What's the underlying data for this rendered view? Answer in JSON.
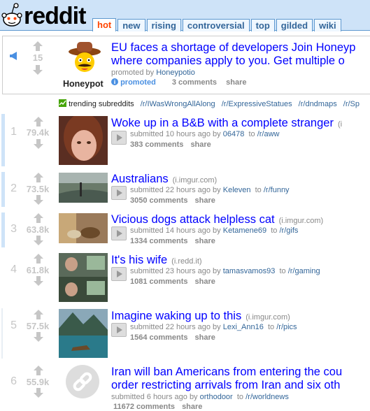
{
  "header": {
    "brand": "reddit",
    "tabs": [
      "hot",
      "new",
      "rising",
      "controversial",
      "top",
      "gilded",
      "wiki"
    ],
    "selected_tab": "hot"
  },
  "promoted": {
    "score": "15",
    "title_line1": "EU faces a shortage of developers Join Honeyp",
    "title_line2": "where companies apply to you. Get multiple o",
    "tagline_prefix": "promoted by",
    "author": "Honeypotio",
    "logo_label": "Honeypot",
    "promoted_label": "promoted",
    "comments": "3 comments",
    "share": "share"
  },
  "trending": {
    "label": "trending subreddits",
    "subs": [
      "/r/IWasWrongAllAlong",
      "/r/ExpressiveStatues",
      "/r/dndmaps",
      "/r/Sp"
    ]
  },
  "posts": [
    {
      "rank": "1",
      "score": "79.4k",
      "title": "Woke up in a B&B with a complete stranger",
      "domain": "(i",
      "age": "10 hours ago",
      "author": "06478",
      "subreddit": "/r/aww",
      "comments": "383 comments",
      "share": "share"
    },
    {
      "rank": "2",
      "score": "73.5k",
      "title": "Australians",
      "domain": "(i.imgur.com)",
      "age": "22 hours ago",
      "author": "Keleven",
      "subreddit": "/r/funny",
      "comments": "3050 comments",
      "share": "share"
    },
    {
      "rank": "3",
      "score": "63.8k",
      "title": "Vicious dogs attack helpless cat",
      "domain": "(i.imgur.com)",
      "age": "14 hours ago",
      "author": "Ketamene69",
      "subreddit": "/r/gifs",
      "comments": "1334 comments",
      "share": "share"
    },
    {
      "rank": "4",
      "score": "61.8k",
      "title": "It's his wife",
      "domain": "(i.redd.it)",
      "age": "23 hours ago",
      "author": "tamasvamos93",
      "subreddit": "/r/gaming",
      "comments": "1081 comments",
      "share": "share"
    },
    {
      "rank": "5",
      "score": "57.5k",
      "title": "Imagine waking up to this",
      "domain": "(i.imgur.com)",
      "age": "22 hours ago",
      "author": "Lexi_Ann16",
      "subreddit": "/r/pics",
      "comments": "1564 comments",
      "share": "share"
    },
    {
      "rank": "6",
      "score": "55.9k",
      "title_line1": "Iran will ban Americans from entering the cou",
      "title_line2": "order restricting arrivals from Iran and six oth",
      "age": "6 hours ago",
      "author": "orthodoor",
      "subreddit": "/r/worldnews",
      "comments": "11672 comments",
      "share": "share"
    }
  ],
  "labels": {
    "submitted": "submitted",
    "by": "by",
    "to": "to"
  },
  "colors": {
    "header_bg": "#cee3f8",
    "link": "#0000ff",
    "selected_tab": "#ff4500",
    "meta_link": "#336699"
  }
}
